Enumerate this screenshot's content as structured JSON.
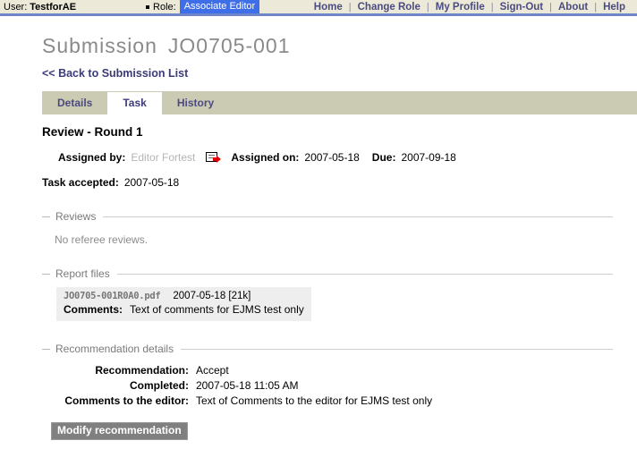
{
  "topbar": {
    "user_label": "User:",
    "user_name": "TestforAE",
    "role_label": "Role:",
    "role_value": "Associate Editor",
    "nav": [
      {
        "label": "Home"
      },
      {
        "label": "Change Role"
      },
      {
        "label": "My Profile"
      },
      {
        "label": "Sign-Out"
      },
      {
        "label": "About"
      },
      {
        "label": "Help"
      }
    ],
    "separator": "|",
    "accent_color": "#3f6fe8",
    "bar_color": "#ece9d8",
    "rule_color": "#6e86c8"
  },
  "page": {
    "title_prefix": "Submission",
    "submission_id": "JO0705-001",
    "back_link": "<< Back to Submission List",
    "title_color": "#8a8a8a",
    "link_color": "#3b3b7a"
  },
  "tabs": {
    "bar_color": "#cbcbb3",
    "items": [
      {
        "label": "Details",
        "active": false
      },
      {
        "label": "Task",
        "active": true
      },
      {
        "label": "History",
        "active": false
      }
    ]
  },
  "task": {
    "heading": "Review - Round 1",
    "assigned_by_label": "Assigned by:",
    "assigned_by_value": "Editor Fortest",
    "mail_icon": "send-mail-icon",
    "assigned_on_label": "Assigned on:",
    "assigned_on_value": "2007-05-18",
    "due_label": "Due:",
    "due_value": "2007-09-18",
    "task_accepted_label": "Task accepted:",
    "task_accepted_value": "2007-05-18"
  },
  "reviews": {
    "section_title": "Reviews",
    "empty_text": "No referee reviews."
  },
  "report_files": {
    "section_title": "Report files",
    "file_name": "JO0705-001R0A0.pdf",
    "file_meta": "2007-05-18 [21k]",
    "comments_label": "Comments:",
    "comments_value": "Text of comments for EJMS test only"
  },
  "recommendation": {
    "section_title": "Recommendation details",
    "rows": [
      {
        "label": "Recommendation:",
        "value": "Accept"
      },
      {
        "label": "Completed:",
        "value": "2007-05-18 11:05 AM"
      },
      {
        "label": "Comments to the editor:",
        "value": "Text of Comments to the editor for EJMS test only"
      }
    ],
    "modify_button": "Modify recommendation"
  }
}
